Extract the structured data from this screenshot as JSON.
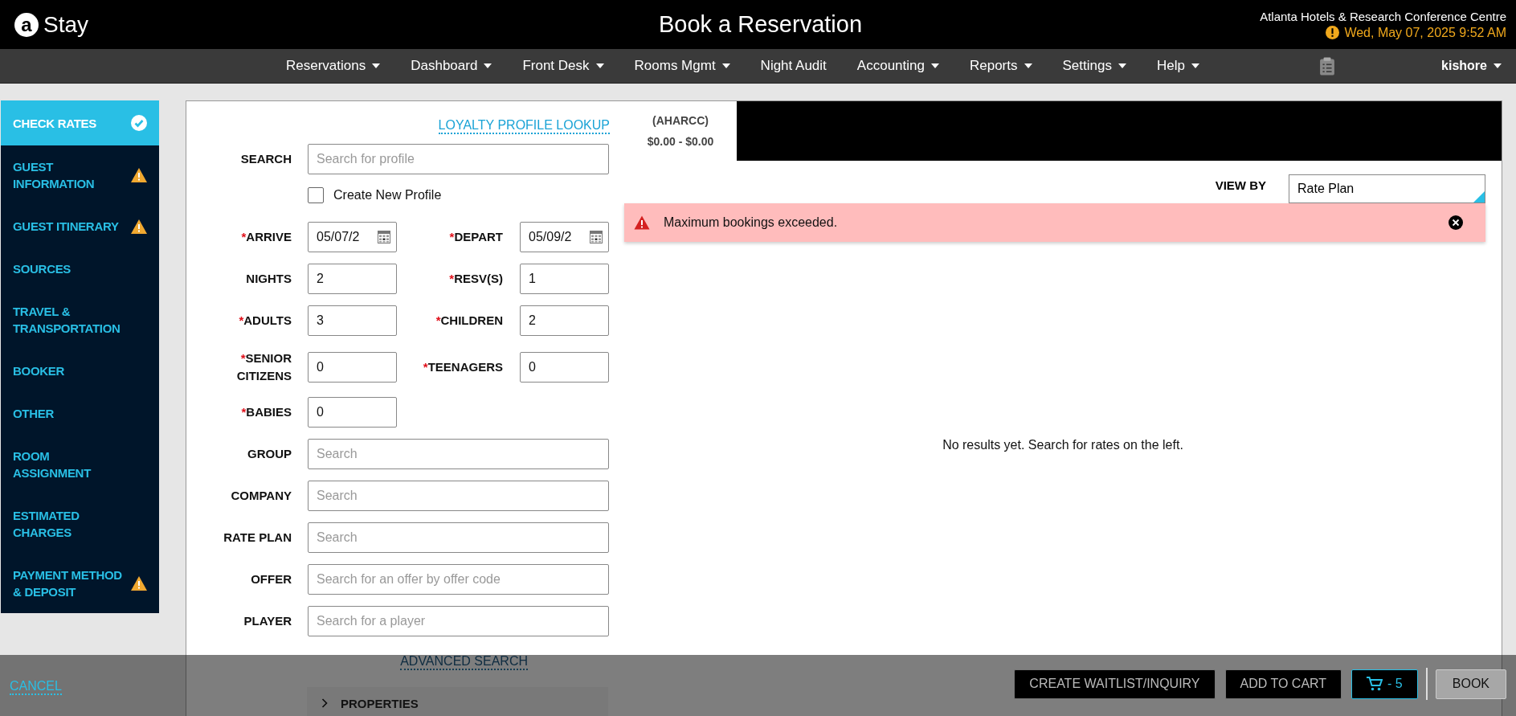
{
  "header": {
    "logo_mark": "a",
    "logo_text": "Stay",
    "title": "Book a Reservation",
    "property": "Atlanta Hotels & Research Conference Centre",
    "datetime": "Wed, May 07, 2025 9:52 AM"
  },
  "nav": {
    "items": [
      {
        "label": "Reservations",
        "dropdown": true
      },
      {
        "label": "Dashboard",
        "dropdown": true
      },
      {
        "label": "Front Desk",
        "dropdown": true
      },
      {
        "label": "Rooms Mgmt",
        "dropdown": true
      },
      {
        "label": "Night Audit",
        "dropdown": false
      },
      {
        "label": "Accounting",
        "dropdown": true
      },
      {
        "label": "Reports",
        "dropdown": true
      },
      {
        "label": "Settings",
        "dropdown": true
      },
      {
        "label": "Help",
        "dropdown": true
      }
    ],
    "user": "kishore"
  },
  "sidebar": {
    "items": [
      {
        "label": "CHECK RATES",
        "complete": true,
        "warning": false,
        "selected": true
      },
      {
        "label": "GUEST INFORMATION",
        "complete": false,
        "warning": true,
        "selected": false
      },
      {
        "label": "GUEST ITINERARY",
        "complete": false,
        "warning": true,
        "selected": false
      },
      {
        "label": "SOURCES",
        "complete": false,
        "warning": false,
        "selected": false
      },
      {
        "label": "TRAVEL & TRANSPORTATION",
        "complete": false,
        "warning": false,
        "selected": false
      },
      {
        "label": "BOOKER",
        "complete": false,
        "warning": false,
        "selected": false
      },
      {
        "label": "OTHER",
        "complete": false,
        "warning": false,
        "selected": false
      },
      {
        "label": "ROOM ASSIGNMENT",
        "complete": false,
        "warning": false,
        "selected": false
      },
      {
        "label": "ESTIMATED CHARGES",
        "complete": false,
        "warning": false,
        "selected": false
      },
      {
        "label": "PAYMENT METHOD & DEPOSIT",
        "complete": false,
        "warning": true,
        "selected": false
      }
    ]
  },
  "form": {
    "loyalty_link": "LOYALTY PROFILE LOOKUP",
    "search": {
      "label": "SEARCH",
      "placeholder": "Search for profile"
    },
    "create_new_profile": {
      "label": "Create New Profile",
      "checked": false
    },
    "pairs": [
      [
        {
          "required_mark": "*",
          "label": "ARRIVE",
          "value": "05/07/2",
          "kind": "date"
        },
        {
          "required_mark": "*",
          "label": "DEPART",
          "value": "05/09/2",
          "kind": "date"
        }
      ],
      [
        {
          "label": "NIGHTS",
          "value": "2",
          "kind": "number"
        },
        {
          "required_mark": "*",
          "label": "RESV(S)",
          "value": "1",
          "kind": "number"
        }
      ],
      [
        {
          "required_mark": "*",
          "label": "ADULTS",
          "value": "3",
          "kind": "number"
        },
        {
          "required_mark": "*",
          "label": "CHILDREN",
          "value": "2",
          "kind": "number"
        }
      ],
      [
        {
          "required_mark": "*",
          "label": "SENIOR CITIZENS",
          "value": "0",
          "kind": "number"
        },
        {
          "required_mark": "*",
          "label": "TEENAGERS",
          "value": "0",
          "kind": "number"
        }
      ],
      [
        {
          "required_mark": "*",
          "label": "BABIES",
          "value": "0",
          "kind": "number"
        }
      ]
    ],
    "search_fields": [
      {
        "label": "GROUP",
        "placeholder": "Search"
      },
      {
        "label": "COMPANY",
        "placeholder": "Search"
      },
      {
        "label": "RATE PLAN",
        "placeholder": "Search"
      },
      {
        "label": "OFFER",
        "placeholder": "Search for an offer by offer code"
      },
      {
        "label": "PLAYER",
        "placeholder": "Search for a player"
      }
    ],
    "advanced_search": "ADVANCED SEARCH",
    "properties": "PROPERTIES"
  },
  "results": {
    "tab": {
      "code": "(AHARCC)",
      "range": "$0.00 - $0.00"
    },
    "view_by": {
      "label": "VIEW BY",
      "value": "Rate Plan"
    },
    "alert": "Maximum bookings exceeded.",
    "empty_message": "No results yet. Search for rates on the left."
  },
  "footer": {
    "cancel": "CANCEL",
    "buttons": [
      {
        "label": "CREATE WAITLIST/INQUIRY",
        "kind": "secondary"
      },
      {
        "label": "ADD TO CART",
        "kind": "secondary"
      },
      {
        "label": "- 5",
        "kind": "cart"
      },
      {
        "label": "BOOK",
        "kind": "primary"
      }
    ]
  }
}
